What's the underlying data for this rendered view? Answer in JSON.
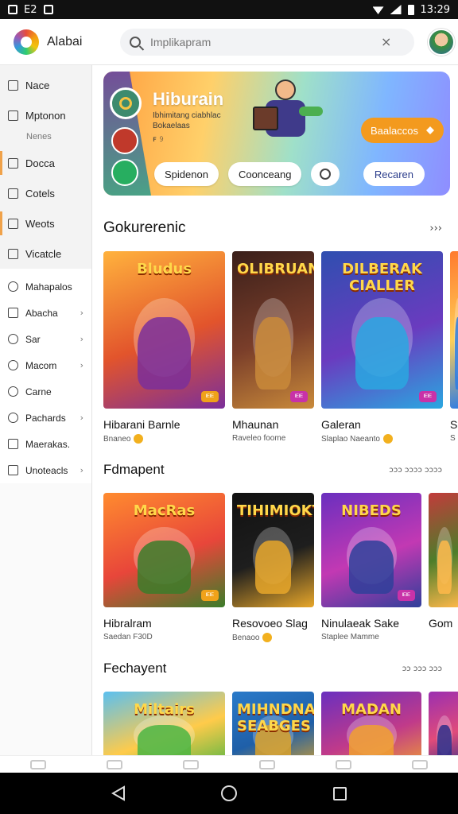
{
  "status_bar": {
    "left_text": "E2",
    "time": "13:29"
  },
  "app": {
    "name": "Alabai"
  },
  "search": {
    "placeholder": "Implikapram",
    "clear_symbol": "×"
  },
  "sidebar": {
    "top_items": [
      {
        "label": "Nace"
      },
      {
        "label": "Mptonon",
        "sub": "Nenes"
      },
      {
        "label": "Docca"
      },
      {
        "label": "Cotels"
      },
      {
        "label": "Weots"
      },
      {
        "label": "Vicatcle"
      }
    ],
    "lower_items": [
      {
        "label": "Mahapalos"
      },
      {
        "label": "Abacha",
        "chevron": "›"
      },
      {
        "label": "Sar",
        "chevron": "›"
      },
      {
        "label": "Macom",
        "chevron": "›"
      },
      {
        "label": "Carne"
      },
      {
        "label": "Pachards",
        "chevron": "›"
      },
      {
        "label": "Maerakas."
      },
      {
        "label": "Unoteacls",
        "chevron": "›"
      }
    ]
  },
  "hero": {
    "title": "Hiburain",
    "line1": "Ibhimitang ciabhlac",
    "line2": "Bokaelaas",
    "line3": "ꜰ 𝟿",
    "cta_label": "Baalaccos",
    "chips": [
      "Spidenon",
      "Coonceang"
    ],
    "right_chip": "Recaren",
    "colors": {
      "cta": "#f39a1e",
      "right_chip_text": "#2c3e8c"
    }
  },
  "sections": [
    {
      "title": "Gokurerenic",
      "more": "›››",
      "cards": [
        {
          "name": "Hibarani Barnle",
          "meta": "Bnaneo",
          "tag": "ᴵᴱᴵᴱ",
          "art_title": "Bludus",
          "coin": true,
          "colors": [
            "#ffb23d",
            "#e2542c",
            "#7b2f9a"
          ],
          "tag_color": "#f0a21a"
        },
        {
          "name": "Mhaunan",
          "meta": "Raveleo foome",
          "tag": "ᴵᴱᴵᴱ",
          "art_title": "OLIBRUAN",
          "coin": false,
          "colors": [
            "#3a1f1a",
            "#7a3e2a",
            "#c98a3a"
          ],
          "tag_color": "#c832a8"
        },
        {
          "name": "Galeran",
          "meta": "Slaplao Naeanto",
          "tag": "ᴵᴱᴵᴱ",
          "art_title": "DILBERAK CIALLER",
          "coin": true,
          "colors": [
            "#2f4fb0",
            "#6a3bbf",
            "#2aa7e0"
          ],
          "tag_color": "#c832a8"
        },
        {
          "name": "S",
          "meta": "S",
          "tag": "",
          "art_title": "",
          "coin": false,
          "colors": [
            "#ff7a2f",
            "#ffcf57",
            "#2c7be5"
          ],
          "tag_color": "#f0a21a"
        }
      ]
    },
    {
      "title": "Fdmapent",
      "more": "ɔɔɔ ɔɔɔɔ  ɔɔɔɔ",
      "cards": [
        {
          "name": "Hibralram",
          "meta": "Saedan F30D",
          "tag": "ᴵᴱᴵᴱ",
          "art_title": "MacRas",
          "coin": false,
          "colors": [
            "#ff8b2f",
            "#e8463a",
            "#3b7d2a"
          ],
          "tag_color": "#f0a21a"
        },
        {
          "name": "Resovoeo Slag",
          "meta": "Benaoo",
          "tag": "",
          "art_title": "TIHIMIOKT",
          "coin": true,
          "colors": [
            "#111111",
            "#1e1e1e",
            "#e8a72a"
          ],
          "tag_color": "#f0a21a"
        },
        {
          "name": "Ninulaeak Sake",
          "meta": "Staplee Mamme",
          "tag": "ᴵᴱᴵᴱ",
          "art_title": "NIBEDS",
          "coin": false,
          "colors": [
            "#6a2fbf",
            "#c239b3",
            "#2f3f9a"
          ],
          "tag_color": "#c832a8"
        },
        {
          "name": "Gom",
          "meta": "",
          "tag": "",
          "art_title": "",
          "coin": false,
          "colors": [
            "#c23b3b",
            "#4d7d2a",
            "#ffb84a"
          ],
          "tag_color": "#f0a21a"
        }
      ]
    },
    {
      "title": "Fechayent",
      "more": "ɔɔ ɔɔɔ  ɔɔɔ",
      "cards": [
        {
          "name": "",
          "meta": "",
          "tag": "",
          "art_title": "Miltairs",
          "coin": false,
          "colors": [
            "#5bc0f0",
            "#ffcb4a",
            "#4bb543"
          ],
          "tag_color": "#f0a21a"
        },
        {
          "name": "",
          "meta": "",
          "tag": "",
          "art_title": "MIHNDNA SEABGES",
          "coin": false,
          "colors": [
            "#2a7ac9",
            "#1f5fa8",
            "#d9a12a"
          ],
          "tag_color": "#f0a21a"
        },
        {
          "name": "",
          "meta": "",
          "tag": "",
          "art_title": "MADAN",
          "coin": false,
          "colors": [
            "#6a2fbf",
            "#c03a8a",
            "#f0a030"
          ],
          "tag_color": "#f0a21a"
        },
        {
          "name": "",
          "meta": "",
          "tag": "",
          "art_title": "",
          "coin": false,
          "colors": [
            "#9b2fb0",
            "#e04b7a",
            "#2f2f8a"
          ],
          "tag_color": "#f0a21a"
        }
      ]
    }
  ]
}
